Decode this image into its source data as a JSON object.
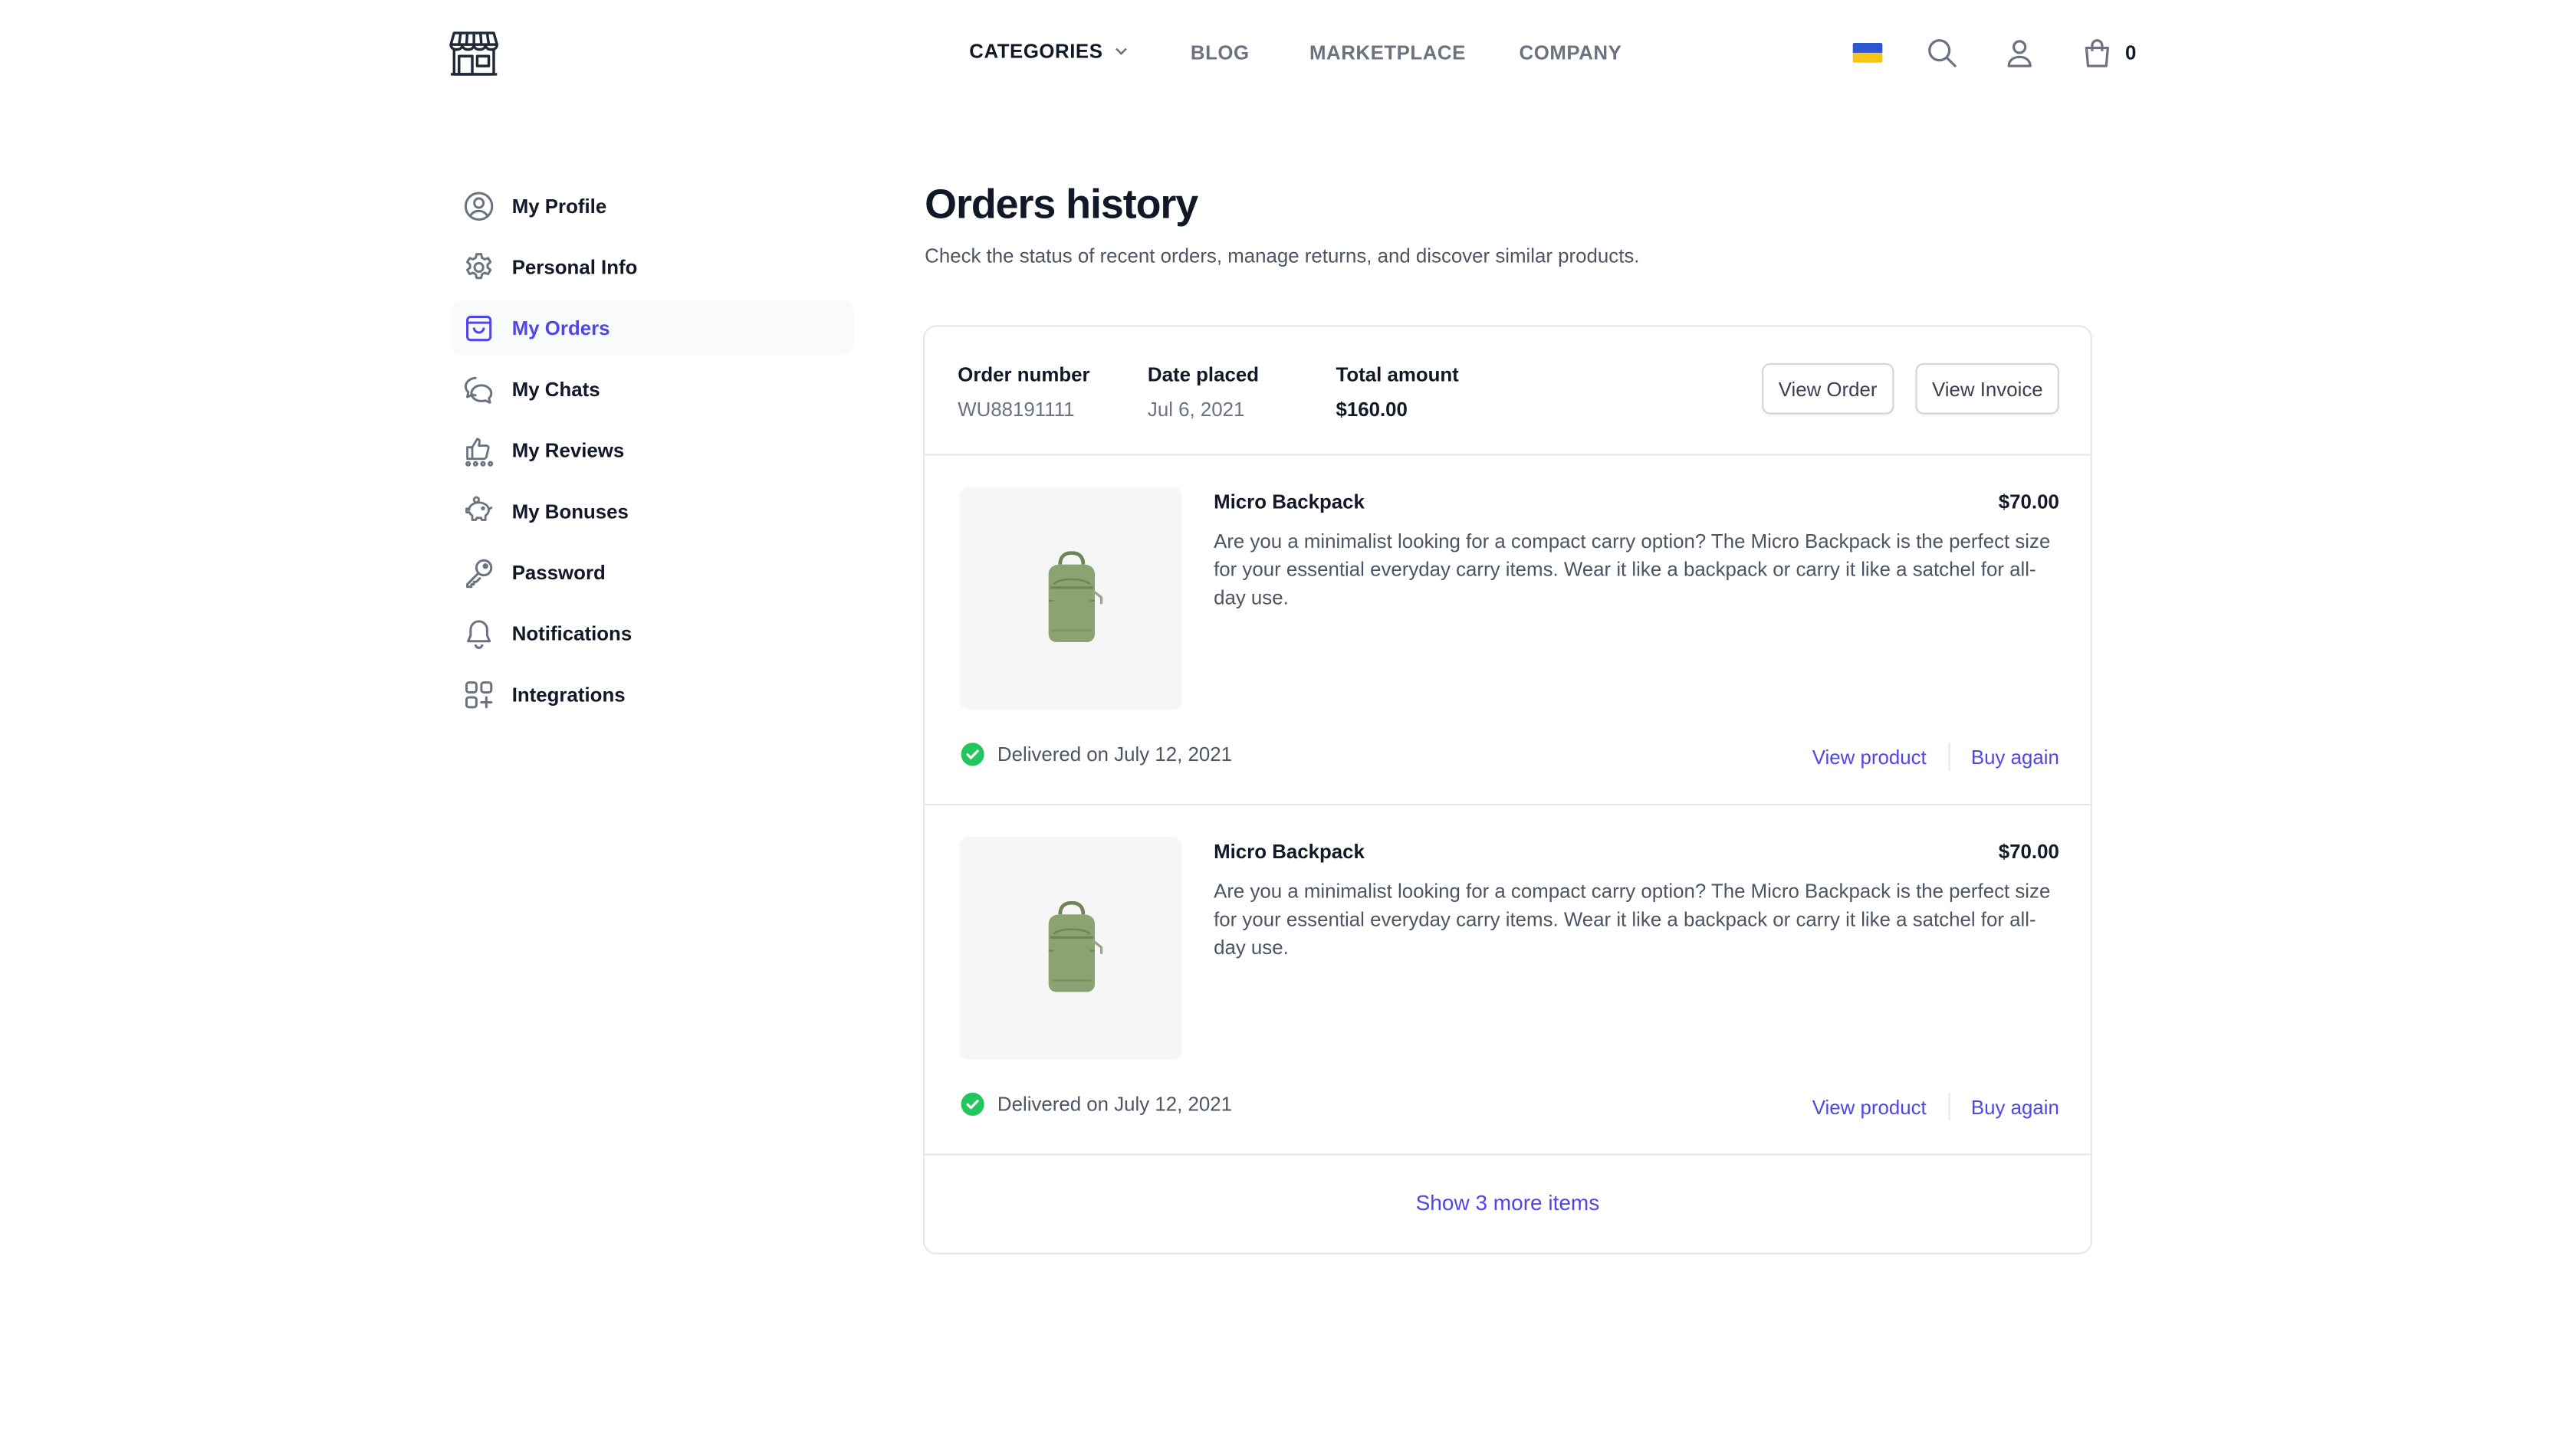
{
  "header": {
    "nav": {
      "categories": "CATEGORIES",
      "blog": "BLOG",
      "marketplace": "MARKETPLACE",
      "company": "COMPANY"
    },
    "cart_count": "0",
    "icons": [
      "store-logo-icon",
      "flag-ukraine-icon",
      "search-icon",
      "user-icon",
      "shopping-bag-icon",
      "chevron-down-icon"
    ]
  },
  "sidebar": {
    "items": [
      {
        "label": "My Profile",
        "icon": "user-circle-icon"
      },
      {
        "label": "Personal Info",
        "icon": "gear-icon"
      },
      {
        "label": "My Orders",
        "icon": "shopping-bag-icon",
        "active": true
      },
      {
        "label": "My Chats",
        "icon": "chat-bubbles-icon"
      },
      {
        "label": "My Reviews",
        "icon": "thumbs-up-icon"
      },
      {
        "label": "My Bonuses",
        "icon": "piggy-bank-icon"
      },
      {
        "label": "Password",
        "icon": "key-icon"
      },
      {
        "label": "Notifications",
        "icon": "bell-icon"
      },
      {
        "label": "Integrations",
        "icon": "squares-plus-icon"
      }
    ]
  },
  "main": {
    "title": "Orders history",
    "subtitle": "Check the status of recent orders, manage returns, and discover similar products.",
    "order": {
      "number_label": "Order number",
      "number": "WU88191111",
      "date_label": "Date placed",
      "date": "Jul 6, 2021",
      "total_label": "Total amount",
      "total": "$160.00",
      "view_order": "View Order",
      "view_invoice": "View Invoice",
      "items": [
        {
          "name": "Micro Backpack",
          "price": "$70.00",
          "description": "Are you a minimalist looking for a compact carry option? The Micro Backpack is the perfect size for your essential everyday carry items. Wear it like a backpack or carry it like a satchel for all-day use.",
          "status": "Delivered on July 12, 2021",
          "view_product": "View product",
          "buy_again": "Buy again"
        },
        {
          "name": "Micro Backpack",
          "price": "$70.00",
          "description": "Are you a minimalist looking for a compact carry option? The Micro Backpack is the perfect size for your essential everyday carry items. Wear it like a backpack or carry it like a satchel for all-day use.",
          "status": "Delivered on July 12, 2021",
          "view_product": "View product",
          "buy_again": "Buy again"
        }
      ],
      "show_more": "Show 3 more items"
    }
  },
  "colors": {
    "accent": "#4f46e5",
    "success": "#22c55e",
    "text": "#111827",
    "muted": "#6b7280",
    "border": "#e5e7eb",
    "backpack": "#8aa370"
  }
}
